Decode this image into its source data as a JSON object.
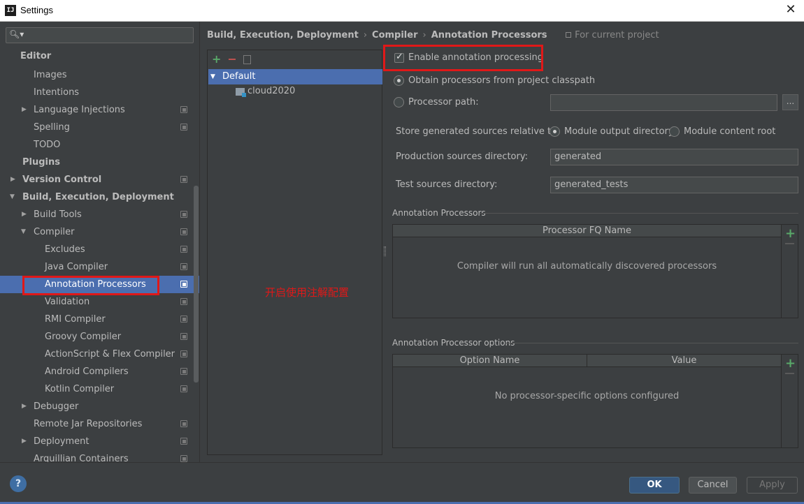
{
  "window": {
    "title": "Settings",
    "app_icon_text": "IJ"
  },
  "search": {
    "placeholder": ""
  },
  "sidebar": {
    "items": [
      {
        "label": "Editor"
      },
      {
        "label": "Images"
      },
      {
        "label": "Intentions"
      },
      {
        "label": "Language Injections"
      },
      {
        "label": "Spelling"
      },
      {
        "label": "TODO"
      },
      {
        "label": "Plugins"
      },
      {
        "label": "Version Control"
      },
      {
        "label": "Build, Execution, Deployment"
      },
      {
        "label": "Build Tools"
      },
      {
        "label": "Compiler"
      },
      {
        "label": "Excludes"
      },
      {
        "label": "Java Compiler"
      },
      {
        "label": "Annotation Processors"
      },
      {
        "label": "Validation"
      },
      {
        "label": "RMI Compiler"
      },
      {
        "label": "Groovy Compiler"
      },
      {
        "label": "ActionScript & Flex Compiler"
      },
      {
        "label": "Android Compilers"
      },
      {
        "label": "Kotlin Compiler"
      },
      {
        "label": "Debugger"
      },
      {
        "label": "Remote Jar Repositories"
      },
      {
        "label": "Deployment"
      },
      {
        "label": "Arquillian Containers"
      }
    ],
    "selected": "Annotation Processors"
  },
  "breadcrumb": {
    "items": [
      "Build, Execution, Deployment",
      "Compiler",
      "Annotation Processors"
    ],
    "separator": "›",
    "scope": "For current project"
  },
  "profiles": {
    "items": [
      {
        "label": "Default"
      },
      {
        "label": "cloud2020"
      }
    ]
  },
  "annotation_note": "开启使用注解配置",
  "settings": {
    "enable_label": "Enable annotation processing",
    "enable_checked": true,
    "obtain_label": "Obtain processors from project classpath",
    "processor_path_label": "Processor path:",
    "processor_path_value": "",
    "browse_label": "...",
    "store_label": "Store generated sources relative to:",
    "module_output_label": "Module output directory",
    "module_content_label": "Module content root",
    "production_label": "Production sources directory:",
    "production_value": "generated",
    "test_label": "Test sources directory:",
    "test_value": "generated_tests"
  },
  "processors": {
    "group_title": "Annotation Processors",
    "column": "Processor FQ Name",
    "empty_text": "Compiler will run all automatically discovered processors"
  },
  "options": {
    "group_title": "Annotation Processor options",
    "columns": [
      "Option Name",
      "Value"
    ],
    "empty_text": "No processor-specific options configured"
  },
  "buttons": {
    "ok": "OK",
    "cancel": "Cancel",
    "apply": "Apply",
    "help": "?"
  },
  "colors": {
    "selection": "#4b6eaf",
    "highlight": "#e01818",
    "add": "#59a869",
    "remove": "#c75450"
  }
}
